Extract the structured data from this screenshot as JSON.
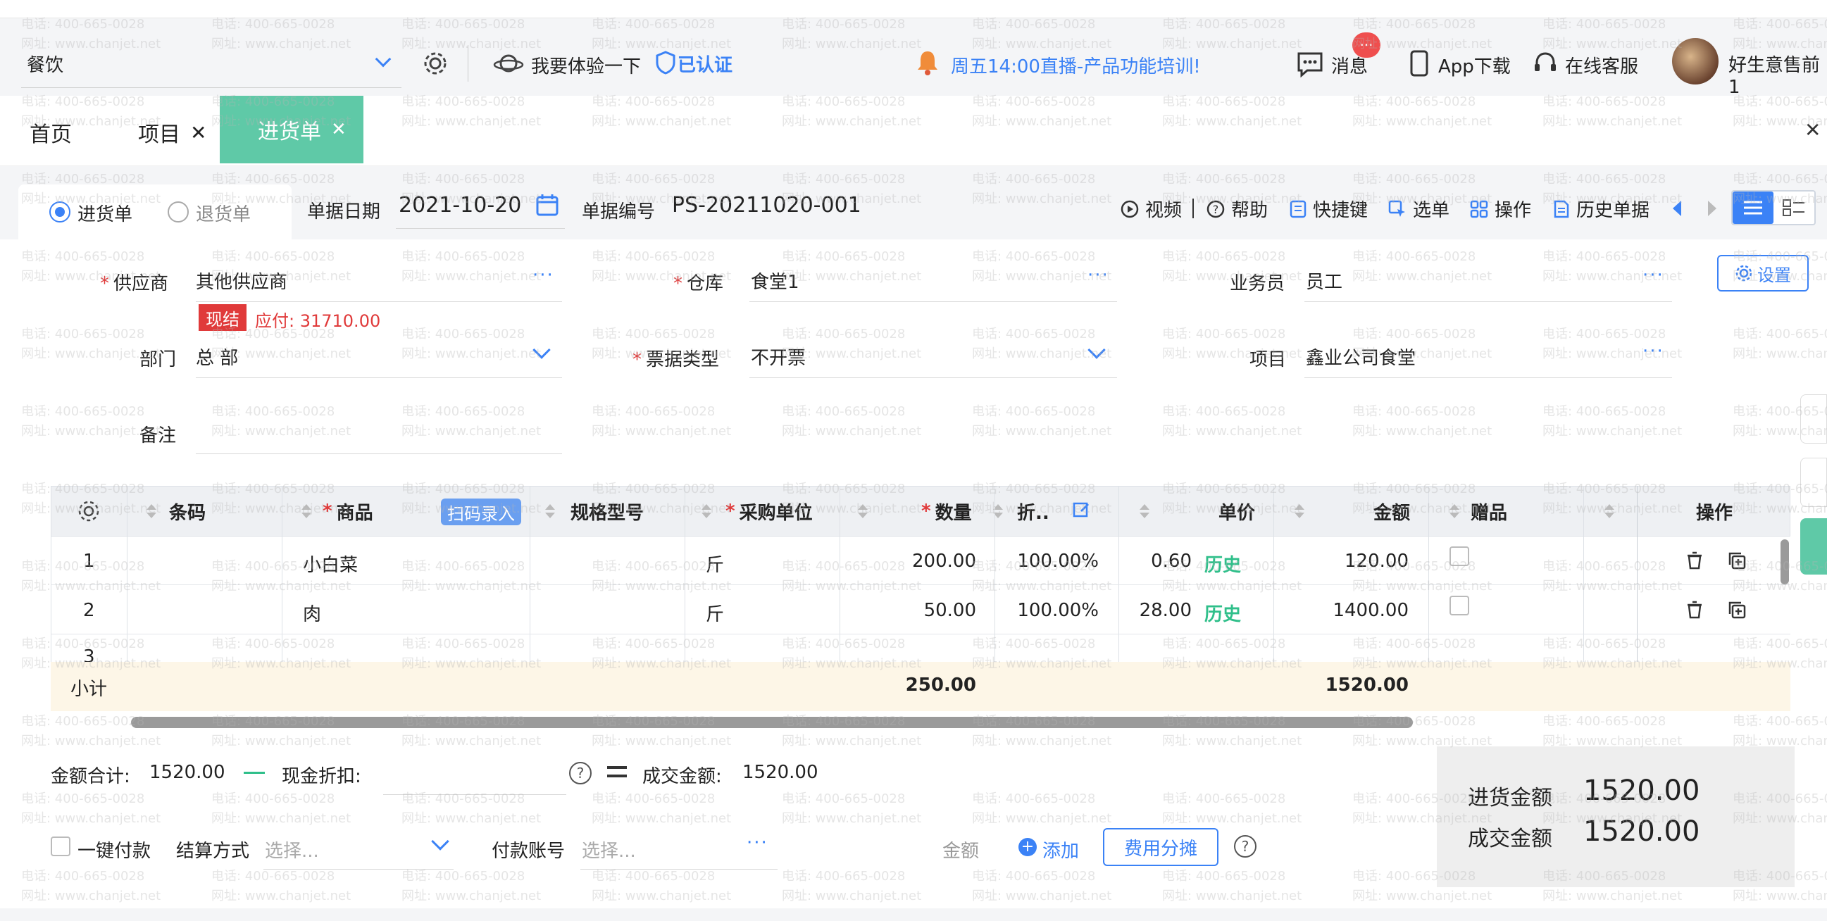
{
  "header": {
    "company_select": "餐饮",
    "try_label": "我要体验一下",
    "verified": "已认证",
    "announcement": "周五14:00直播-产品功能培训!",
    "messages": "消息",
    "app_download": "App下载",
    "online_service": "在线客服",
    "user_name": "好生意售前1",
    "badge": "···"
  },
  "tabs": [
    {
      "label": "首页"
    },
    {
      "label": "项目"
    },
    {
      "label": "进货单"
    }
  ],
  "toolbar": {
    "radio_purchase": "进货单",
    "radio_return": "退货单",
    "date_label": "单据日期",
    "date_value": "2021-10-20",
    "number_label": "单据编号",
    "number_value": "PS-20211020-001",
    "video": "视频",
    "help": "帮助",
    "shortcuts": "快捷键",
    "select": "选单",
    "operations": "操作",
    "history": "历史单据",
    "settings": "设置"
  },
  "form": {
    "supplier_label": "供应商",
    "supplier_value": "其他供应商",
    "cash_tag": "现结",
    "payable": "应付: 31710.00",
    "warehouse_label": "仓库",
    "warehouse_value": "食堂1",
    "salesman_label": "业务员",
    "salesman_value": "员工",
    "dept_label": "部门",
    "dept_value": "总 部",
    "invoice_label": "票据类型",
    "invoice_value": "不开票",
    "project_label": "项目",
    "project_value": "鑫业公司食堂",
    "remark_label": "备注"
  },
  "table": {
    "headers": {
      "barcode": "条码",
      "product": "商品",
      "scan": "扫码录入",
      "spec": "规格型号",
      "unit": "采购单位",
      "qty": "数量",
      "discount": "折..",
      "price": "单价",
      "amount": "金额",
      "gift": "赠品",
      "ops": "操作"
    },
    "rows": [
      {
        "no": "1",
        "product": "小白菜",
        "unit": "斤",
        "qty": "200.00",
        "discount": "100.00%",
        "price": "0.60",
        "hist": "历史",
        "amount": "120.00"
      },
      {
        "no": "2",
        "product": "肉",
        "unit": "斤",
        "qty": "50.00",
        "discount": "100.00%",
        "price": "28.00",
        "hist": "历史",
        "amount": "1400.00"
      },
      {
        "no": "3"
      }
    ],
    "subtotal_label": "小计",
    "subtotal_qty": "250.00",
    "subtotal_amount": "1520.00"
  },
  "footer": {
    "total_label": "金额合计:",
    "total_value": "1520.00",
    "cash_discount_label": "现金折扣:",
    "deal_label": "成交金额:",
    "deal_value": "1520.00",
    "one_click_pay": "一键付款",
    "settle_label": "结算方式",
    "settle_placeholder": "选择...",
    "account_label": "付款账号",
    "account_placeholder": "选择...",
    "amount_label": "金额",
    "add_label": "添加",
    "cost_split": "费用分摊",
    "purchase_amount_label": "进货金额",
    "purchase_amount_value": "1520.00",
    "deal_amount_label": "成交金额",
    "deal_amount_value": "1520.00"
  },
  "watermark": {
    "phone": "电话: 400-665-0028",
    "site": "网址: www.chanjet.net"
  },
  "colors": {
    "accent": "#3b82f6",
    "tab_active": "#5fc9a7",
    "required": "#e03a3a",
    "history": "#2fbf8a",
    "announcement": "#3b82f6"
  }
}
